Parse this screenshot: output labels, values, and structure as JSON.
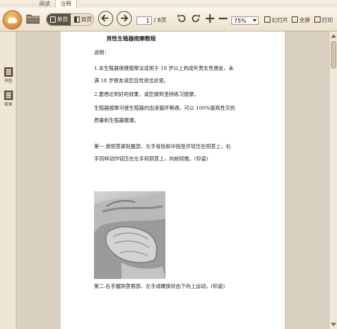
{
  "tabs": [
    {
      "label": "阅读"
    },
    {
      "label": "注释"
    }
  ],
  "toolbar": {
    "view_single": "单页",
    "view_double": "双页",
    "page_current": "1",
    "page_total": "/ 8页",
    "zoom": "75%",
    "slides": "幻灯片",
    "fullscreen": "全屏",
    "print": "打印"
  },
  "sidebar": {
    "bookmark": "书签",
    "toc": "目录"
  },
  "document": {
    "title": "男性生殖器按摩教程",
    "lines": [
      "说明：",
      "1.本生殖器保健按摩法适用于 18 岁以上的成年男女性朋友，未",
      "满 18 岁朋友请您自觉退出这里。",
      "2.要想达到好的效果，请您做到坚持练习按摩。",
      "生殖器按摩可使生殖器的血液循环畅通，可以 100%提高性交的",
      "质量和生殖器健康。",
      "第一.使阴茎紧贴腹部，左手食指和中指张开轻压在阴茎上，右",
      "手同样动作轻压在左手和阴茎上，向前轻推。(仰姿)",
      "第二.右手握阴茎根部，左手成螺旋状由下向上运动。(仰姿)"
    ]
  }
}
